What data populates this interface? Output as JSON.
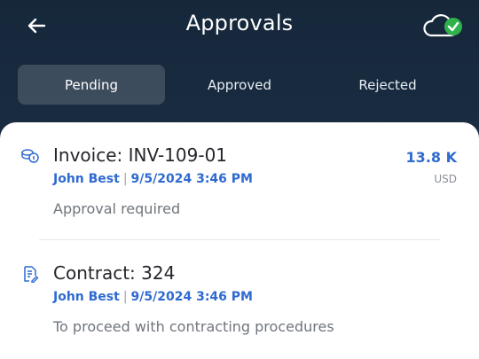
{
  "header": {
    "title": "Approvals"
  },
  "tabs": [
    {
      "label": "Pending",
      "active": true
    },
    {
      "label": "Approved",
      "active": false
    },
    {
      "label": "Rejected",
      "active": false
    }
  ],
  "items": [
    {
      "icon": "coins-icon",
      "title": "Invoice: INV-109-01",
      "author": "John Best",
      "date": "9/5/2024 3:46 PM",
      "description": "Approval required",
      "amount": "13.8 K",
      "currency": "USD"
    },
    {
      "icon": "document-edit-icon",
      "title": "Contract: 324",
      "author": "John Best",
      "date": "9/5/2024 3:46 PM",
      "description": "To proceed with contracting procedures"
    }
  ],
  "colors": {
    "header_bg": "#16273a",
    "accent": "#2f6ad1",
    "sync_ok": "#2fb24c"
  }
}
